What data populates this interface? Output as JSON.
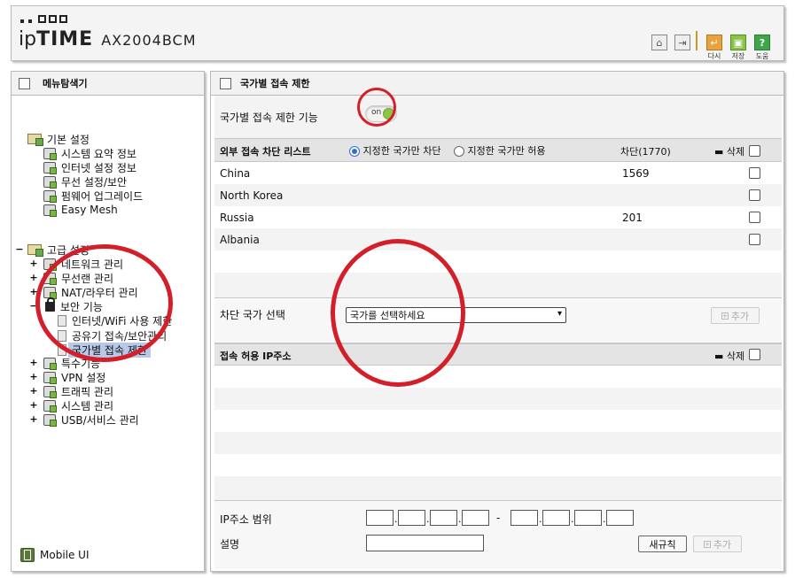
{
  "header": {
    "model": "AX2004BCM",
    "logo_ip": "ip",
    "logo_time": "TIME",
    "buttons": {
      "home_icon": "home-icon",
      "logout_icon": "logout-icon",
      "apply_label": "다시",
      "save_label": "저장",
      "help_label": "도움",
      "help_glyph": "?"
    }
  },
  "sidebar": {
    "title": "메뉴탐색기",
    "basic": {
      "label": "기본 설정",
      "items": [
        "시스템 요약 정보",
        "인터넷 설정 정보",
        "무선 설정/보안",
        "펌웨어 업그레이드",
        "Easy Mesh"
      ]
    },
    "advanced": {
      "toggle": "−",
      "label": "고급 설정",
      "items": [
        {
          "toggle": "+",
          "label": "네트워크 관리"
        },
        {
          "toggle": "+",
          "label": "무선랜 관리"
        },
        {
          "toggle": "+",
          "label": "NAT/라우터 관리"
        },
        {
          "toggle": "−",
          "label": "보안 기능"
        }
      ],
      "security_sub": [
        "인터넷/WiFi 사용 제한",
        "공유기 접속/보안관리",
        "국가별 접속 제한"
      ],
      "more": [
        {
          "toggle": "+",
          "label": "특수기능"
        },
        {
          "toggle": "+",
          "label": "VPN 설정"
        },
        {
          "toggle": "+",
          "label": "트래픽 관리"
        },
        {
          "toggle": "+",
          "label": "시스템 관리"
        },
        {
          "toggle": "+",
          "label": "USB/서비스 관리"
        }
      ]
    },
    "mobile_ui": "Mobile UI"
  },
  "main": {
    "title": "국가별 접속 제한",
    "feature_label": "국가별 접속 제한 기능",
    "toggle_label": "on",
    "block_list": {
      "header": "외부 접속 차단 리스트",
      "radio_block": "지정한 국가만 차단",
      "radio_allow": "지정한 국가만 허용",
      "count_label": "차단(1770)",
      "delete_label": "삭제",
      "rows": [
        {
          "country": "China",
          "count": "1569"
        },
        {
          "country": "North Korea",
          "count": ""
        },
        {
          "country": "Russia",
          "count": "201"
        },
        {
          "country": "Albania",
          "count": ""
        }
      ]
    },
    "country_select": {
      "label": "차단 국가 선택",
      "value": "국가를 선택하세요",
      "add_label": "추가"
    },
    "allow_list": {
      "header": "접속 허용 IP주소",
      "delete_label": "삭제"
    },
    "ip_range": {
      "label": "IP주소 범위",
      "dash": "-",
      "desc_label": "설명",
      "new_rule": "새규칙",
      "add_label": "추가"
    }
  }
}
